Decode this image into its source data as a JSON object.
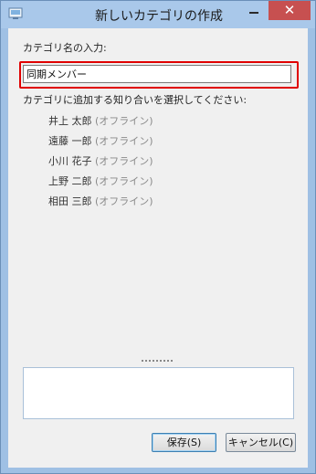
{
  "window": {
    "title": "新しいカテゴリの作成",
    "close_glyph": "✕"
  },
  "form": {
    "category_name_label": "カテゴリ名の入力:",
    "category_name_value": "同期メンバー",
    "contacts_label": "カテゴリに追加する知り合いを選択してください:"
  },
  "contacts": [
    {
      "name": "井上 太郎",
      "status": "(オフライン)"
    },
    {
      "name": "遠藤 一郎",
      "status": "(オフライン)"
    },
    {
      "name": "小川 花子",
      "status": "(オフライン)"
    },
    {
      "name": "上野 二郎",
      "status": "(オフライン)"
    },
    {
      "name": "相田 三郎",
      "status": "(オフライン)"
    }
  ],
  "buttons": {
    "save": "保存(S)",
    "cancel": "キャンセル(C)"
  },
  "colors": {
    "highlight": "#e00000",
    "close_button": "#c75050"
  }
}
